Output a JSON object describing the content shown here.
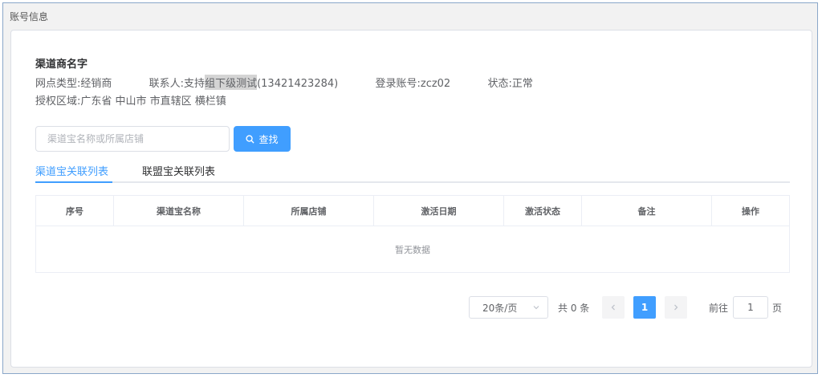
{
  "section_title": "账号信息",
  "profile": {
    "name": "渠道商名字",
    "network_type": "网点类型:经销商",
    "contact_prefix": "联系人:支持",
    "contact_highlight": "组下级测试",
    "contact_phone": "(13421423284)",
    "login_account": "登录账号:zcz02",
    "status": "状态:正常",
    "region": "授权区域:广东省 中山市 市直辖区 横栏镇"
  },
  "search": {
    "placeholder": "渠道宝名称或所属店铺",
    "button_label": "查找",
    "icon": "search-icon"
  },
  "tabs": [
    {
      "label": "渠道宝关联列表",
      "active": true
    },
    {
      "label": "联盟宝关联列表",
      "active": false
    }
  ],
  "table": {
    "columns": [
      "序号",
      "渠道宝名称",
      "所属店铺",
      "激活日期",
      "激活状态",
      "备注",
      "操作"
    ],
    "rows": [],
    "empty_text": "暂无数据"
  },
  "pagination": {
    "page_size": "20条/页",
    "total": "共 0 条",
    "current_page": "1",
    "goto_label": "前往",
    "goto_value": "1",
    "goto_unit": "页"
  },
  "colors": {
    "primary": "#409eff",
    "highlight": "#d4d4d4"
  }
}
